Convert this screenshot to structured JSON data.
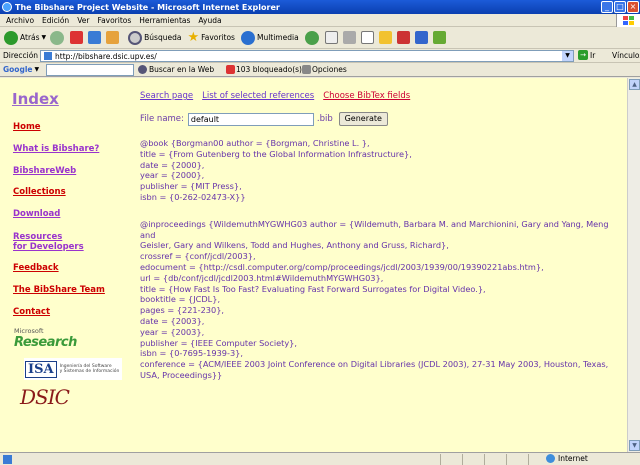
{
  "window": {
    "title": "The Bibshare Project Website - Microsoft Internet Explorer"
  },
  "menu": [
    "Archivo",
    "Edición",
    "Ver",
    "Favoritos",
    "Herramientas",
    "Ayuda"
  ],
  "toolbar": {
    "back": "Atrás",
    "search": "Búsqueda",
    "favorites": "Favoritos",
    "media": "Multimedia"
  },
  "address": {
    "label": "Dirección",
    "url": "http://bibshare.dsic.upv.es/",
    "go": "Ir",
    "links": "Vínculos"
  },
  "google": {
    "brand": "Google",
    "search_web": "Buscar en la Web",
    "blocked": "103 bloqueado(s)",
    "options": "Opciones"
  },
  "sidebar": {
    "title": "Index",
    "items": [
      {
        "label": "Home"
      },
      {
        "label": "What is Bibshare?"
      },
      {
        "label": "BibshareWeb"
      },
      {
        "label": "Collections"
      },
      {
        "label": "Download"
      },
      {
        "label": "Resources"
      },
      {
        "label": "for Developers"
      },
      {
        "label": "Feedback"
      },
      {
        "label": "The BibShare Team"
      },
      {
        "label": "Contact"
      }
    ],
    "ms_small": "Microsoft",
    "ms_research": "Research",
    "isai_logo": "ISA",
    "isai_text_1": "Ingeniería del Software",
    "isai_text_2": "y Sistemas de Información",
    "dsic": "DSIC"
  },
  "topnav": {
    "search": "Search page",
    "list": "List of selected references",
    "choose": "Choose BibTex fields"
  },
  "file": {
    "label": "File name:",
    "value": "default",
    "ext": ".bib",
    "generate": "Generate"
  },
  "entries": {
    "e1": [
      "@book {Borgman00 author = {Borgman, Christine L. },",
      "title = {From Gutenberg to the Global Information Infrastructure},",
      "date = {2000},",
      "year = {2000},",
      "publisher = {MIT Press},",
      "isbn = {0-262-02473-X}}"
    ],
    "e2": [
      "@inproceedings {WildemuthMYGWHG03 author = {Wildemuth, Barbara M. and Marchionini, Gary and Yang, Meng and",
      "Geisler, Gary and Wilkens, Todd and Hughes, Anthony and Gruss, Richard},",
      "crossref = {conf/jcdl/2003},",
      "edocument = {http://csdl.computer.org/comp/proceedings/jcdl/2003/1939/00/19390221abs.htm},",
      "url = {db/conf/jcdl/jcdl2003.html#WildemuthMYGWHG03},",
      "title = {How Fast Is Too Fast? Evaluating Fast Forward Surrogates for Digital Video.},",
      "booktitle = {JCDL},",
      "pages = {221-230},",
      "date = {2003},",
      "year = {2003},",
      "publisher = {IEEE Computer Society},",
      "isbn = {0-7695-1939-3},",
      "conference = {ACM/IEEE 2003 Joint Conference on Digital Libraries (JCDL 2003), 27-31 May 2003, Houston, Texas,",
      "USA, Proceedings}}"
    ]
  },
  "status": {
    "zone": "Internet"
  }
}
